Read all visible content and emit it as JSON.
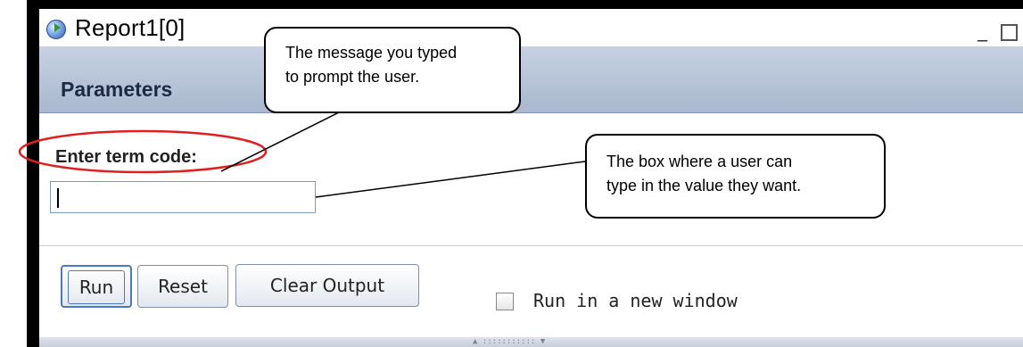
{
  "window": {
    "title": "Report1[0]",
    "minimize_glyph": "_"
  },
  "panel": {
    "title": "Parameters"
  },
  "prompt": {
    "label": "Enter term code:",
    "value": ""
  },
  "buttons": {
    "run": "Run",
    "reset": "Reset",
    "clear_output": "Clear Output"
  },
  "checkbox": {
    "label": "Run in a new window",
    "checked": false
  },
  "splitter": {
    "glyphs": "▲ ::::::::::: ▼"
  },
  "callouts": {
    "message": {
      "line1": "The message you typed",
      "line2": "to prompt the user."
    },
    "box": {
      "line1": "The box where a user can",
      "line2": "type in the value they want."
    }
  },
  "colors": {
    "highlight_ellipse": "#e02020",
    "header_gradient_top": "#c6d1e2",
    "run_button_border": "#4a79c4"
  },
  "icons": {
    "title": "report-globe-icon",
    "minimize": "minimize-icon",
    "maximize": "maximize-icon"
  }
}
